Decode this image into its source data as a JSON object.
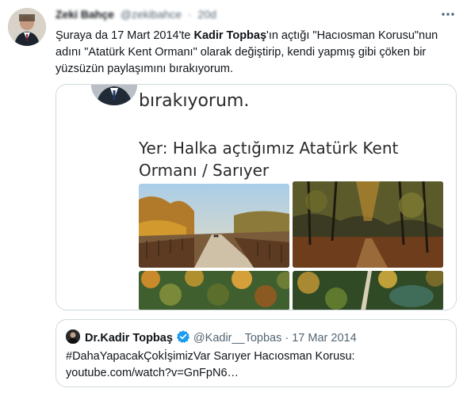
{
  "tweet": {
    "author_name": "Zeki Bahçe",
    "author_handle": "@zekibahce",
    "separator": "·",
    "time": "20d",
    "more_icon": "more-horizontal-icon",
    "text_parts": {
      "p1": "Şuraya da 17 Mart 2014'te ",
      "bold": "Kadir Topbaş",
      "p2": "'ın açtığı \"Hacıosman Korusu\"nun adını \"Atatürk Kent Ormanı\" olarak değiştirip, kendi yapmış gibi çöken bir yüzsüzün paylaşımını bırakıyorum."
    },
    "media": {
      "line1": "bırakıyorum.",
      "line2": "Yer: Halka açtığımız Atatürk Kent Ormanı / Sarıyer"
    }
  },
  "quote": {
    "name": "Dr.Kadir Topbaş",
    "verified_icon": "verified-badge-icon",
    "handle": "@Kadir__Topbas",
    "separator": "·",
    "date": "17 Mar 2014",
    "text_line1": "#DahaYapacakÇokİşimizVar Sarıyer Hacıosman Korusu:",
    "text_line2": "youtube.com/watch?v=GnFpN6…"
  },
  "colors": {
    "text": "#0f1419",
    "secondary": "#536471",
    "border": "#cfd9de",
    "verified": "#1d9bf0"
  }
}
